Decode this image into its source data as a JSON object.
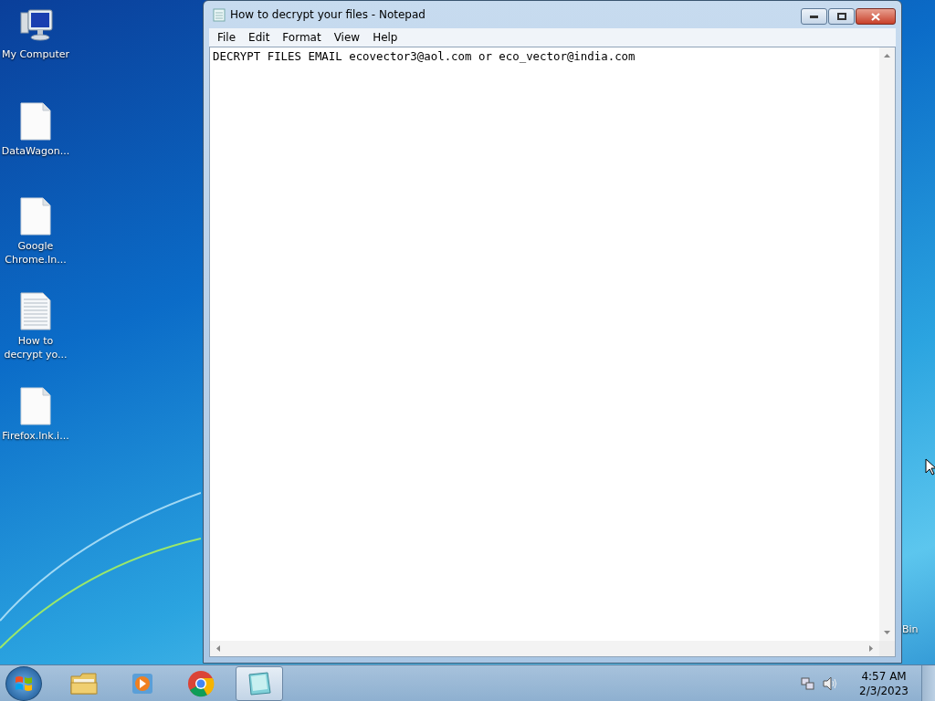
{
  "desktop": {
    "icons": [
      {
        "kind": "computer",
        "label": "My Computer"
      },
      {
        "kind": "blank",
        "label": "DataWagon..."
      },
      {
        "kind": "blank",
        "label": "Google Chrome.In..."
      },
      {
        "kind": "text",
        "label": "How to decrypt yo..."
      },
      {
        "kind": "blank",
        "label": "Firefox.lnk.i..."
      }
    ],
    "partial_label": "Bin"
  },
  "window": {
    "title": "How to decrypt your files - Notepad",
    "menu": [
      "File",
      "Edit",
      "Format",
      "View",
      "Help"
    ],
    "content": "DECRYPT FILES EMAIL ecovector3@aol.com or eco_vector@india.com"
  },
  "taskbar": {
    "items": [
      {
        "kind": "folder",
        "selected": false
      },
      {
        "kind": "media",
        "selected": false
      },
      {
        "kind": "chrome",
        "selected": false
      },
      {
        "kind": "notepad",
        "selected": true
      }
    ],
    "time": "4:57 AM",
    "date": "2/3/2023"
  }
}
